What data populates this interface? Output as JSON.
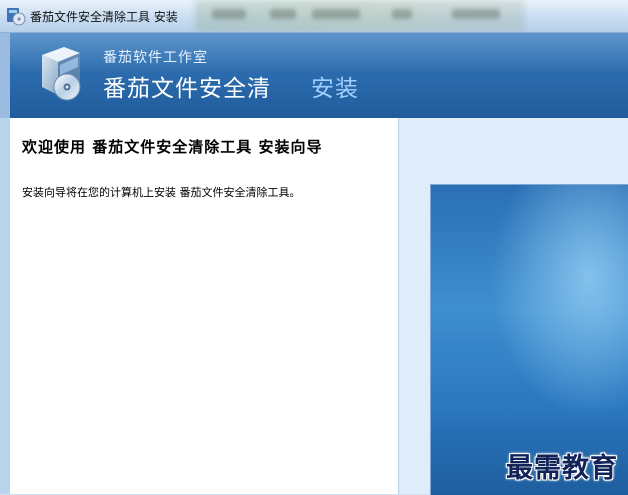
{
  "window": {
    "title": "番茄文件安全清除工具 安装"
  },
  "header": {
    "company": "番茄软件工作室",
    "product": "番茄文件安全清",
    "install": "安装"
  },
  "welcome": {
    "title": "欢迎使用 番茄文件安全清除工具 安装向导",
    "description": "安装向导将在您的计算机上安装 番茄文件安全清除工具。"
  },
  "watermark": "最需教育",
  "icons": {
    "app": "installer-app-icon",
    "logo": "installer-box-cd-logo"
  },
  "colors": {
    "header_blue": "#2c6cae",
    "install_accent": "#9fd0ff",
    "right_panel_bg": "#deedf9"
  }
}
